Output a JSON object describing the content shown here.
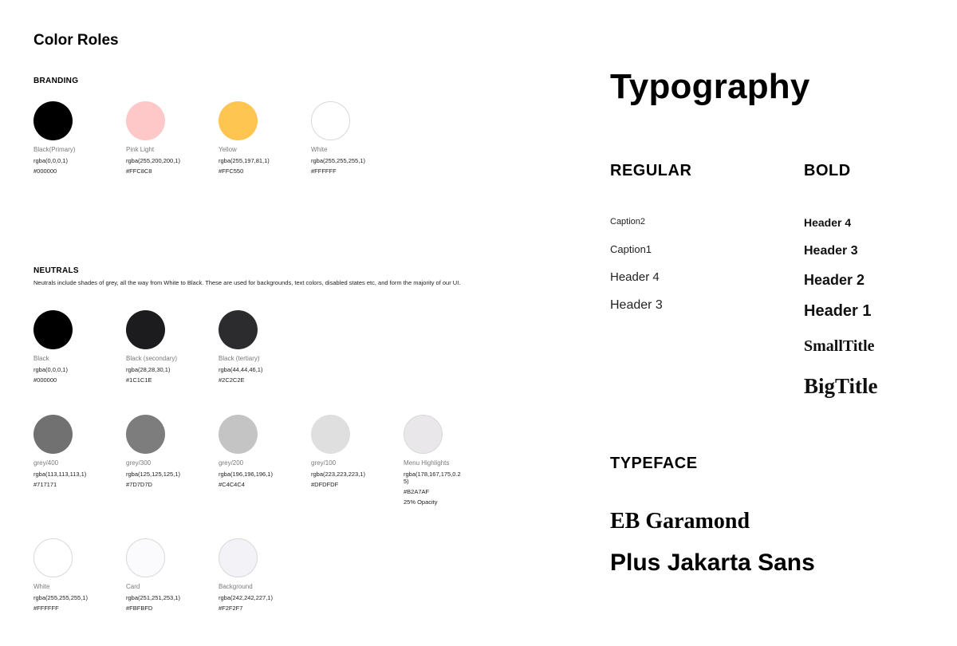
{
  "color_roles": {
    "title": "Color Roles",
    "branding": {
      "label": "BRANDING",
      "swatches": [
        {
          "name": "Black(Primary)",
          "rgba": "rgba(0,0,0,1)",
          "hex": "#000000",
          "color": "#000000"
        },
        {
          "name": "Pink Light",
          "rgba": "rgba(255,200,200,1)",
          "hex": "#FFC8C8",
          "color": "#FFC8C8"
        },
        {
          "name": "Yellow",
          "rgba": "rgba(255,197,81,1)",
          "hex": "#FFC550",
          "color": "#FFC550"
        },
        {
          "name": "White",
          "rgba": "rgba(255,255,255,1)",
          "hex": "#FFFFFF",
          "color": "#FFFFFF"
        }
      ]
    },
    "neutrals": {
      "label": "NEUTRALS",
      "description": "Neutrals include shades of grey, all the way from White to Black. These are used for backgrounds, text colors, disabled states etc, and form the majority of our UI.",
      "row1": [
        {
          "name": "Black",
          "rgba": "rgba(0,0,0,1)",
          "hex": "#000000",
          "color": "#000000"
        },
        {
          "name": "Black (secondary)",
          "rgba": "rgba(28,28,30,1)",
          "hex": "#1C1C1E",
          "color": "#1C1C1E"
        },
        {
          "name": "Black (tertiary)",
          "rgba": "rgba(44,44,46,1)",
          "hex": "#2C2C2E",
          "color": "#2C2C2E"
        }
      ],
      "row2": [
        {
          "name": "grey/400",
          "rgba": "rgba(113,113,113,1)",
          "hex": "#717171",
          "color": "#717171"
        },
        {
          "name": "grey/300",
          "rgba": "rgba(125,125,125,1)",
          "hex": "#7D7D7D",
          "color": "#7D7D7D"
        },
        {
          "name": "grey/200",
          "rgba": "rgba(196,196,196,1)",
          "hex": "#C4C4C4",
          "color": "#C4C4C4"
        },
        {
          "name": "grey/100",
          "rgba": "rgba(223,223,223,1)",
          "hex": "#DFDFDF",
          "color": "#DFDFDF"
        },
        {
          "name": "Menu Highlights",
          "rgba": "rgba(178,167,175,0.25)",
          "hex": "#B2A7AF",
          "note": "25% Opacity",
          "color": "#E9E7E9"
        }
      ],
      "row3": [
        {
          "name": "White",
          "rgba": "rgba(255,255,255,1)",
          "hex": "#FFFFFF",
          "color": "#FFFFFF"
        },
        {
          "name": "Card",
          "rgba": "rgba(251,251,253,1)",
          "hex": "#FBFBFD",
          "color": "#FBFBFD"
        },
        {
          "name": "Background",
          "rgba": "rgba(242,242,227,1)",
          "hex": "#F2F2F7",
          "color": "#F2F2F7"
        }
      ]
    }
  },
  "typography": {
    "title": "Typography",
    "regular": {
      "label": "REGULAR",
      "items": [
        "Caption2",
        "Caption1",
        "Header 4",
        "Header 3"
      ]
    },
    "bold": {
      "label": "BOLD",
      "items": [
        "Header 4",
        "Header 3",
        "Header 2",
        "Header 1",
        "SmallTitle",
        "BigTitle"
      ]
    },
    "typeface": {
      "label": "TYPEFACE",
      "items": [
        "EB Garamond",
        "Plus Jakarta Sans"
      ]
    }
  }
}
